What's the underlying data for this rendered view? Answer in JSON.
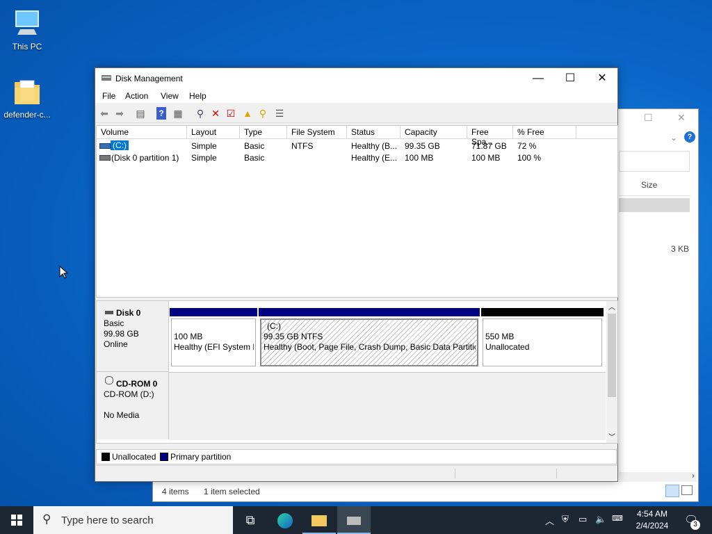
{
  "desktop": {
    "icons": [
      {
        "label": "This PC"
      },
      {
        "label": "defender-c..."
      }
    ]
  },
  "explorer": {
    "column_size": "Size",
    "file_size": "3 KB",
    "status_items": "4 items",
    "status_selected": "1 item selected"
  },
  "window": {
    "title": "Disk Management",
    "menu": [
      "File",
      "Action",
      "View",
      "Help"
    ],
    "columns": [
      "Volume",
      "Layout",
      "Type",
      "File System",
      "Status",
      "Capacity",
      "Free Spa...",
      "% Free"
    ],
    "rows": [
      {
        "volume": "(C:)",
        "layout": "Simple",
        "type": "Basic",
        "fs": "NTFS",
        "status": "Healthy (B...",
        "capacity": "99.35 GB",
        "free": "71.87 GB",
        "pct": "72 %"
      },
      {
        "volume": "(Disk 0 partition 1)",
        "layout": "Simple",
        "type": "Basic",
        "fs": "",
        "status": "Healthy (E...",
        "capacity": "100 MB",
        "free": "100 MB",
        "pct": "100 %"
      }
    ],
    "disks": {
      "disk0": {
        "name": "Disk 0",
        "type": "Basic",
        "size": "99.98 GB",
        "state": "Online",
        "parts": [
          {
            "line1": "100 MB",
            "line2": "Healthy (EFI System P"
          },
          {
            "title": "(C:)",
            "line1": "99.35 GB NTFS",
            "line2": "Healthy (Boot, Page File, Crash Dump, Basic Data Partition)"
          },
          {
            "line1": "550 MB",
            "line2": "Unallocated"
          }
        ]
      },
      "cdrom": {
        "name": "CD-ROM 0",
        "type": "CD-ROM (D:)",
        "media": "No Media"
      }
    },
    "legend": [
      "Unallocated",
      "Primary partition"
    ]
  },
  "taskbar": {
    "search_placeholder": "Type here to search",
    "time": "4:54 AM",
    "date": "2/4/2024",
    "notifications": "3"
  },
  "colors": {
    "primary": "#000080",
    "unallocated": "#000000",
    "selection": "#0078d7"
  }
}
